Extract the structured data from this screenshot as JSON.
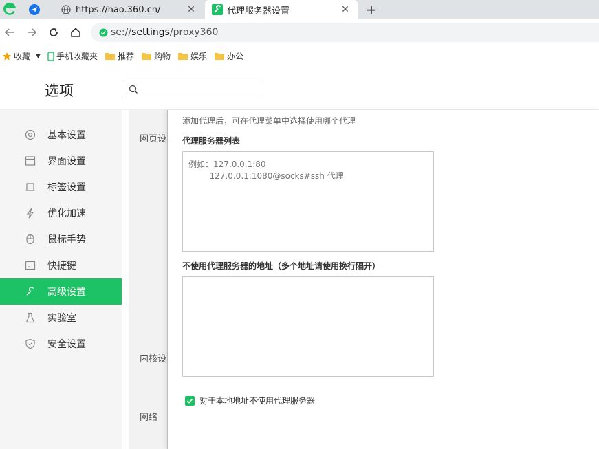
{
  "tabs": [
    {
      "title": "https://hao.360.cn/",
      "active": false
    },
    {
      "title": "代理服务器设置",
      "active": true
    }
  ],
  "omnibox": {
    "scheme": "se://",
    "host": "settings",
    "path": "/proxy360"
  },
  "bookmarks": [
    {
      "label": "收藏",
      "icon": "star-icon"
    },
    {
      "label": "手机收藏夹",
      "icon": "phone-icon"
    },
    {
      "label": "推荐",
      "icon": "folder-icon"
    },
    {
      "label": "购物",
      "icon": "folder-icon"
    },
    {
      "label": "娱乐",
      "icon": "folder-icon"
    },
    {
      "label": "办公",
      "icon": "folder-icon"
    }
  ],
  "settings": {
    "title": "选项",
    "search_placeholder": ""
  },
  "sidebar": {
    "items": [
      {
        "label": "基本设置",
        "icon": "gear-icon"
      },
      {
        "label": "界面设置",
        "icon": "window-icon"
      },
      {
        "label": "标签设置",
        "icon": "tab-icon"
      },
      {
        "label": "优化加速",
        "icon": "lightning-icon"
      },
      {
        "label": "鼠标手势",
        "icon": "mouse-icon"
      },
      {
        "label": "快捷键",
        "icon": "keyboard-icon"
      },
      {
        "label": "高级设置",
        "icon": "wrench-icon",
        "active": true
      },
      {
        "label": "实验室",
        "icon": "flask-icon"
      },
      {
        "label": "安全设置",
        "icon": "shield-icon"
      }
    ]
  },
  "sections": [
    {
      "label": "网页设置"
    },
    {
      "label": "内核设置"
    },
    {
      "label": "网络"
    }
  ],
  "proxy_panel": {
    "hint": "添加代理后，可在代理菜单中选择使用哪个代理",
    "list_label": "代理服务器列表",
    "list_placeholder": "例如：127.0.0.1:80\n        127.0.0.1:1080@socks#ssh 代理",
    "bypass_label": "不使用代理服务器的地址（多个地址请使用换行隔开）",
    "bypass_value": "",
    "local_bypass_label": "对于本地地址不使用代理服务器",
    "local_bypass_checked": true
  },
  "colors": {
    "accent": "#1ec266"
  }
}
